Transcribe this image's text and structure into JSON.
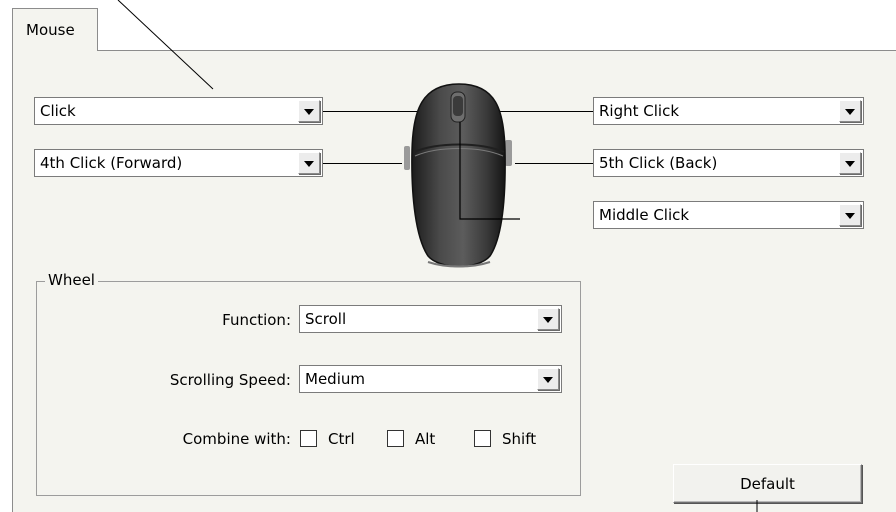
{
  "tab": {
    "label": "Mouse"
  },
  "buttons": {
    "left": {
      "value": "Click"
    },
    "side4": {
      "value": "4th Click (Forward)"
    },
    "right": {
      "value": "Right Click"
    },
    "side5": {
      "value": "5th Click (Back)"
    },
    "middle": {
      "value": "Middle Click"
    }
  },
  "wheel": {
    "title": "Wheel",
    "function_label": "Function:",
    "function_value": "Scroll",
    "speed_label": "Scrolling Speed:",
    "speed_value": "Medium",
    "combine_label": "Combine with:",
    "modifiers": [
      {
        "label": "Ctrl",
        "checked": false
      },
      {
        "label": "Alt",
        "checked": false
      },
      {
        "label": "Shift",
        "checked": false
      }
    ]
  },
  "default_button": {
    "label": "Default"
  },
  "colors": {
    "panel_bg": "#f4f4ef",
    "border": "#8c8c8c",
    "mouse_body": "#3a3a3a"
  }
}
